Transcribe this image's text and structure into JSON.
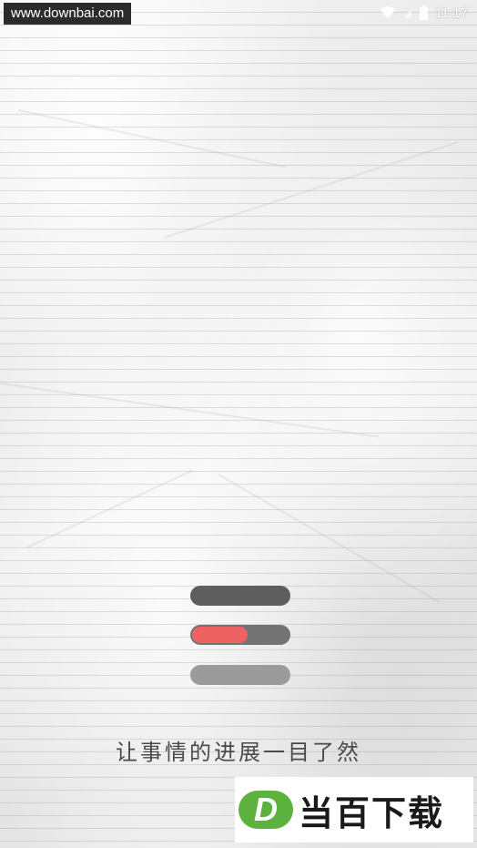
{
  "status_bar": {
    "watermark_url": "www.downbai.com",
    "time": "11:17",
    "icons": [
      "wifi-icon",
      "signal-icon",
      "battery-icon"
    ]
  },
  "illustration": {
    "bars": [
      {
        "color": "#5e5e5e"
      },
      {
        "color": "#737373",
        "fill_color": "#ee6263",
        "fill_fraction": 0.58
      },
      {
        "color": "#9b9b9b"
      }
    ]
  },
  "tagline": "让事情的进展一目了然",
  "brand": {
    "logo_letter": "D",
    "name": "当百下载",
    "logo_color": "#5db13e"
  }
}
